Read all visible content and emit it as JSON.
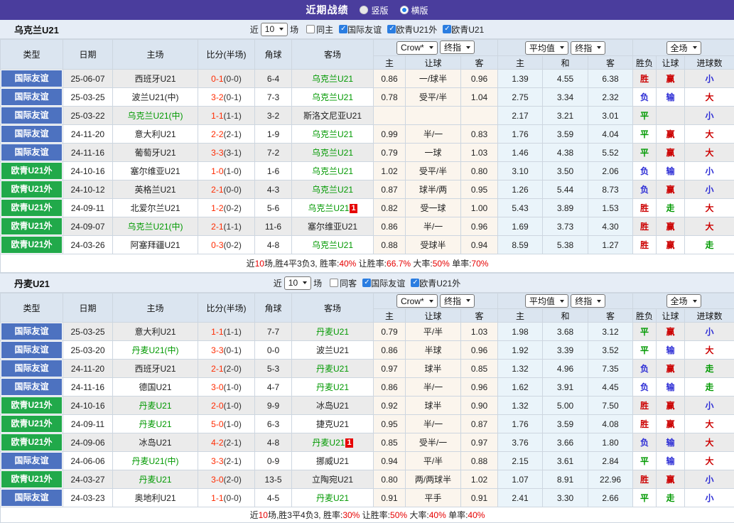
{
  "colors": {
    "accent_purple": "#4a3d9d",
    "type_blue": "#4d72c0",
    "type_green": "#21a94a",
    "team_green": "#009900",
    "score_red": "#ff2a00",
    "win_red": "#cc0000",
    "lose_blue": "#2b2bd5",
    "draw_green": "#009900",
    "summary_red": "#e60000",
    "checkbox_blue": "#2a7de1"
  },
  "title_bar": {
    "title": "近期战绩",
    "radio_vertical": "竖版",
    "radio_horizontal": "横版"
  },
  "labels": {
    "near": "近",
    "count": "10",
    "games": "场",
    "type": "类型",
    "date": "日期",
    "home": "主场",
    "score": "比分(半场)",
    "corner": "角球",
    "away": "客场",
    "sub": [
      "主",
      "让球",
      "客",
      "主",
      "和",
      "客",
      "胜负",
      "让球",
      "进球数"
    ],
    "selects": {
      "crow": "Crow*",
      "final": "终指",
      "avg": "平均值",
      "final2": "终指",
      "scope": "全场"
    }
  },
  "tables": [
    {
      "team": "乌克兰U21",
      "filters": [
        {
          "label": "同主",
          "state": "off"
        },
        {
          "label": "国际友谊",
          "state": "on"
        },
        {
          "label": "欧青U21外",
          "state": "on"
        },
        {
          "label": "欧青U21",
          "state": "on"
        }
      ],
      "rows": [
        {
          "type": "国际友谊",
          "type_color": "bgblue",
          "date": "25-06-07",
          "home": "西班牙U21",
          "home_color": "dark",
          "score": "0-1",
          "half": "(0-0)",
          "corner": "6-4",
          "away": "乌克兰U21",
          "away_color": "green",
          "crow_home": "0.86",
          "handicap": "一/球半",
          "crow_away": "0.96",
          "avg_home": "1.39",
          "avg_draw": "4.55",
          "avg_away": "6.38",
          "result": "胜",
          "result_color": "red",
          "let_result": "赢",
          "let_color": "red",
          "goal_result": "小",
          "goal_color": "blue"
        },
        {
          "type": "国际友谊",
          "type_color": "bgblue",
          "date": "25-03-25",
          "home": "波兰U21(中)",
          "home_color": "dark",
          "score": "3-2",
          "half": "(0-1)",
          "corner": "7-3",
          "away": "乌克兰U21",
          "away_color": "green",
          "crow_home": "0.78",
          "handicap": "受平/半",
          "crow_away": "1.04",
          "avg_home": "2.75",
          "avg_draw": "3.34",
          "avg_away": "2.32",
          "result": "负",
          "result_color": "blue",
          "let_result": "输",
          "let_color": "blue",
          "goal_result": "大",
          "goal_color": "red"
        },
        {
          "type": "国际友谊",
          "type_color": "bgblue",
          "date": "25-03-22",
          "home": "乌克兰U21(中)",
          "home_color": "green",
          "score": "1-1",
          "half": "(1-1)",
          "corner": "3-2",
          "away": "斯洛文尼亚U21",
          "away_color": "dark",
          "crow_home": "",
          "handicap": "",
          "crow_away": "",
          "avg_home": "2.17",
          "avg_draw": "3.21",
          "avg_away": "3.01",
          "result": "平",
          "result_color": "green",
          "let_result": "",
          "let_color": "dark",
          "goal_result": "小",
          "goal_color": "blue"
        },
        {
          "type": "国际友谊",
          "type_color": "bgblue",
          "date": "24-11-20",
          "home": "意大利U21",
          "home_color": "dark",
          "score": "2-2",
          "half": "(2-1)",
          "corner": "1-9",
          "away": "乌克兰U21",
          "away_color": "green",
          "crow_home": "0.99",
          "handicap": "半/一",
          "crow_away": "0.83",
          "avg_home": "1.76",
          "avg_draw": "3.59",
          "avg_away": "4.04",
          "result": "平",
          "result_color": "green",
          "let_result": "赢",
          "let_color": "red",
          "goal_result": "大",
          "goal_color": "red"
        },
        {
          "type": "国际友谊",
          "type_color": "bgblue",
          "date": "24-11-16",
          "home": "葡萄牙U21",
          "home_color": "dark",
          "score": "3-3",
          "half": "(3-1)",
          "corner": "7-2",
          "away": "乌克兰U21",
          "away_color": "green",
          "crow_home": "0.79",
          "handicap": "一球",
          "crow_away": "1.03",
          "avg_home": "1.46",
          "avg_draw": "4.38",
          "avg_away": "5.52",
          "result": "平",
          "result_color": "green",
          "let_result": "赢",
          "let_color": "red",
          "goal_result": "大",
          "goal_color": "red"
        },
        {
          "type": "欧青U21外",
          "type_color": "bggreen",
          "date": "24-10-16",
          "home": "塞尔维亚U21",
          "home_color": "dark",
          "score": "1-0",
          "half": "(1-0)",
          "corner": "1-6",
          "away": "乌克兰U21",
          "away_color": "green",
          "crow_home": "1.02",
          "handicap": "受平/半",
          "crow_away": "0.80",
          "avg_home": "3.10",
          "avg_draw": "3.50",
          "avg_away": "2.06",
          "result": "负",
          "result_color": "blue",
          "let_result": "输",
          "let_color": "blue",
          "goal_result": "小",
          "goal_color": "blue"
        },
        {
          "type": "欧青U21外",
          "type_color": "bggreen",
          "date": "24-10-12",
          "home": "英格兰U21",
          "home_color": "dark",
          "score": "2-1",
          "half": "(0-0)",
          "corner": "4-3",
          "away": "乌克兰U21",
          "away_color": "green",
          "crow_home": "0.87",
          "handicap": "球半/两",
          "crow_away": "0.95",
          "avg_home": "1.26",
          "avg_draw": "5.44",
          "avg_away": "8.73",
          "result": "负",
          "result_color": "blue",
          "let_result": "赢",
          "let_color": "red",
          "goal_result": "小",
          "goal_color": "blue"
        },
        {
          "type": "欧青U21外",
          "type_color": "bggreen",
          "date": "24-09-11",
          "home": "北爱尔兰U21",
          "home_color": "dark",
          "score": "1-2",
          "half": "(0-2)",
          "corner": "5-6",
          "away": "乌克兰U21",
          "away_color": "green",
          "away_badge": "1",
          "crow_home": "0.82",
          "handicap": "受一球",
          "crow_away": "1.00",
          "avg_home": "5.43",
          "avg_draw": "3.89",
          "avg_away": "1.53",
          "result": "胜",
          "result_color": "red",
          "let_result": "走",
          "let_color": "green",
          "goal_result": "大",
          "goal_color": "red"
        },
        {
          "type": "欧青U21外",
          "type_color": "bggreen",
          "date": "24-09-07",
          "home": "乌克兰U21(中)",
          "home_color": "green",
          "score": "2-1",
          "half": "(1-1)",
          "corner": "11-6",
          "away": "塞尔维亚U21",
          "away_color": "dark",
          "crow_home": "0.86",
          "handicap": "半/一",
          "crow_away": "0.96",
          "avg_home": "1.69",
          "avg_draw": "3.73",
          "avg_away": "4.30",
          "result": "胜",
          "result_color": "red",
          "let_result": "赢",
          "let_color": "red",
          "goal_result": "大",
          "goal_color": "red"
        },
        {
          "type": "欧青U21外",
          "type_color": "bggreen",
          "date": "24-03-26",
          "home": "阿塞拜疆U21",
          "home_color": "dark",
          "score": "0-3",
          "half": "(0-2)",
          "corner": "4-8",
          "away": "乌克兰U21",
          "away_color": "green",
          "crow_home": "0.88",
          "handicap": "受球半",
          "crow_away": "0.94",
          "avg_home": "8.59",
          "avg_draw": "5.38",
          "avg_away": "1.27",
          "result": "胜",
          "result_color": "red",
          "let_result": "赢",
          "let_color": "red",
          "goal_result": "走",
          "goal_color": "green"
        }
      ],
      "summary": [
        {
          "t": "近",
          "cls": "dark"
        },
        {
          "t": "10",
          "cls": "sumred"
        },
        {
          "t": "场,胜4平3负3, 胜率:",
          "cls": "dark"
        },
        {
          "t": "40%",
          "cls": "sumred"
        },
        {
          "t": " 让胜率:",
          "cls": "dark"
        },
        {
          "t": "66.7%",
          "cls": "sumred"
        },
        {
          "t": " 大率:",
          "cls": "dark"
        },
        {
          "t": "50%",
          "cls": "sumred"
        },
        {
          "t": " 单率:",
          "cls": "dark"
        },
        {
          "t": "70%",
          "cls": "sumred"
        }
      ]
    },
    {
      "team": "丹麦U21",
      "filters": [
        {
          "label": "同客",
          "state": "off"
        },
        {
          "label": "国际友谊",
          "state": "on"
        },
        {
          "label": "欧青U21外",
          "state": "on"
        }
      ],
      "rows": [
        {
          "type": "国际友谊",
          "type_color": "bgblue",
          "date": "25-03-25",
          "home": "意大利U21",
          "home_color": "dark",
          "score": "1-1",
          "half": "(1-1)",
          "corner": "7-7",
          "away": "丹麦U21",
          "away_color": "green",
          "crow_home": "0.79",
          "handicap": "平/半",
          "crow_away": "1.03",
          "avg_home": "1.98",
          "avg_draw": "3.68",
          "avg_away": "3.12",
          "result": "平",
          "result_color": "green",
          "let_result": "赢",
          "let_color": "red",
          "goal_result": "小",
          "goal_color": "blue"
        },
        {
          "type": "国际友谊",
          "type_color": "bgblue",
          "date": "25-03-20",
          "home": "丹麦U21(中)",
          "home_color": "green",
          "score": "3-3",
          "half": "(0-1)",
          "corner": "0-0",
          "away": "波兰U21",
          "away_color": "dark",
          "crow_home": "0.86",
          "handicap": "半球",
          "crow_away": "0.96",
          "avg_home": "1.92",
          "avg_draw": "3.39",
          "avg_away": "3.52",
          "result": "平",
          "result_color": "green",
          "let_result": "输",
          "let_color": "blue",
          "goal_result": "大",
          "goal_color": "red"
        },
        {
          "type": "国际友谊",
          "type_color": "bgblue",
          "date": "24-11-20",
          "home": "西班牙U21",
          "home_color": "dark",
          "score": "2-1",
          "half": "(2-0)",
          "corner": "5-3",
          "away": "丹麦U21",
          "away_color": "green",
          "crow_home": "0.97",
          "handicap": "球半",
          "crow_away": "0.85",
          "avg_home": "1.32",
          "avg_draw": "4.96",
          "avg_away": "7.35",
          "result": "负",
          "result_color": "blue",
          "let_result": "赢",
          "let_color": "red",
          "goal_result": "走",
          "goal_color": "green"
        },
        {
          "type": "国际友谊",
          "type_color": "bgblue",
          "date": "24-11-16",
          "home": "德国U21",
          "home_color": "dark",
          "score": "3-0",
          "half": "(1-0)",
          "corner": "4-7",
          "away": "丹麦U21",
          "away_color": "green",
          "crow_home": "0.86",
          "handicap": "半/一",
          "crow_away": "0.96",
          "avg_home": "1.62",
          "avg_draw": "3.91",
          "avg_away": "4.45",
          "result": "负",
          "result_color": "blue",
          "let_result": "输",
          "let_color": "blue",
          "goal_result": "走",
          "goal_color": "green"
        },
        {
          "type": "欧青U21外",
          "type_color": "bggreen",
          "date": "24-10-16",
          "home": "丹麦U21",
          "home_color": "green",
          "score": "2-0",
          "half": "(1-0)",
          "corner": "9-9",
          "away": "冰岛U21",
          "away_color": "dark",
          "crow_home": "0.92",
          "handicap": "球半",
          "crow_away": "0.90",
          "avg_home": "1.32",
          "avg_draw": "5.00",
          "avg_away": "7.50",
          "result": "胜",
          "result_color": "red",
          "let_result": "赢",
          "let_color": "red",
          "goal_result": "小",
          "goal_color": "blue"
        },
        {
          "type": "欧青U21外",
          "type_color": "bggreen",
          "date": "24-09-11",
          "home": "丹麦U21",
          "home_color": "green",
          "score": "5-0",
          "half": "(1-0)",
          "corner": "6-3",
          "away": "捷克U21",
          "away_color": "dark",
          "crow_home": "0.95",
          "handicap": "半/一",
          "crow_away": "0.87",
          "avg_home": "1.76",
          "avg_draw": "3.59",
          "avg_away": "4.08",
          "result": "胜",
          "result_color": "red",
          "let_result": "赢",
          "let_color": "red",
          "goal_result": "大",
          "goal_color": "red"
        },
        {
          "type": "欧青U21外",
          "type_color": "bggreen",
          "date": "24-09-06",
          "home": "冰岛U21",
          "home_color": "dark",
          "score": "4-2",
          "half": "(2-1)",
          "corner": "4-8",
          "away": "丹麦U21",
          "away_color": "green",
          "away_badge": "1",
          "crow_home": "0.85",
          "handicap": "受半/一",
          "crow_away": "0.97",
          "avg_home": "3.76",
          "avg_draw": "3.66",
          "avg_away": "1.80",
          "result": "负",
          "result_color": "blue",
          "let_result": "输",
          "let_color": "blue",
          "goal_result": "大",
          "goal_color": "red"
        },
        {
          "type": "国际友谊",
          "type_color": "bgblue",
          "date": "24-06-06",
          "home": "丹麦U21(中)",
          "home_color": "green",
          "score": "3-3",
          "half": "(2-1)",
          "corner": "0-9",
          "away": "挪威U21",
          "away_color": "dark",
          "crow_home": "0.94",
          "handicap": "平/半",
          "crow_away": "0.88",
          "avg_home": "2.15",
          "avg_draw": "3.61",
          "avg_away": "2.84",
          "result": "平",
          "result_color": "green",
          "let_result": "输",
          "let_color": "blue",
          "goal_result": "大",
          "goal_color": "red"
        },
        {
          "type": "欧青U21外",
          "type_color": "bggreen",
          "date": "24-03-27",
          "home": "丹麦U21",
          "home_color": "green",
          "score": "3-0",
          "half": "(2-0)",
          "corner": "13-5",
          "away": "立陶宛U21",
          "away_color": "dark",
          "crow_home": "0.80",
          "handicap": "两/两球半",
          "crow_away": "1.02",
          "avg_home": "1.07",
          "avg_draw": "8.91",
          "avg_away": "22.96",
          "result": "胜",
          "result_color": "red",
          "let_result": "赢",
          "let_color": "red",
          "goal_result": "小",
          "goal_color": "blue"
        },
        {
          "type": "国际友谊",
          "type_color": "bgblue",
          "date": "24-03-23",
          "home": "奥地利U21",
          "home_color": "dark",
          "score": "1-1",
          "half": "(0-0)",
          "corner": "4-5",
          "away": "丹麦U21",
          "away_color": "green",
          "crow_home": "0.91",
          "handicap": "平手",
          "crow_away": "0.91",
          "avg_home": "2.41",
          "avg_draw": "3.30",
          "avg_away": "2.66",
          "result": "平",
          "result_color": "green",
          "let_result": "走",
          "let_color": "green",
          "goal_result": "小",
          "goal_color": "blue"
        }
      ],
      "summary": [
        {
          "t": "近",
          "cls": "dark"
        },
        {
          "t": "10",
          "cls": "sumred"
        },
        {
          "t": "场,胜3平4负3, 胜率:",
          "cls": "dark"
        },
        {
          "t": "30%",
          "cls": "sumred"
        },
        {
          "t": " 让胜率:",
          "cls": "dark"
        },
        {
          "t": "50%",
          "cls": "sumred"
        },
        {
          "t": " 大率:",
          "cls": "dark"
        },
        {
          "t": "40%",
          "cls": "sumred"
        },
        {
          "t": " 单率:",
          "cls": "dark"
        },
        {
          "t": "40%",
          "cls": "sumred"
        }
      ]
    }
  ]
}
